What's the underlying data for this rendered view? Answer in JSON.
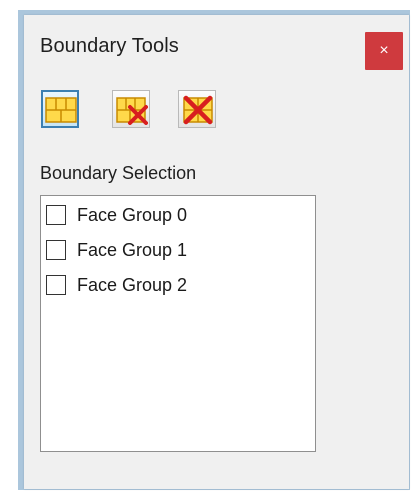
{
  "window": {
    "title": "Boundary Tools",
    "close_label": "×"
  },
  "toolbar": {
    "buttons": [
      {
        "icon": "grid-select-icon",
        "selected": true
      },
      {
        "icon": "grid-remove-icon",
        "selected": false
      },
      {
        "icon": "delete-icon",
        "selected": false
      }
    ]
  },
  "boundary_selection": {
    "label": "Boundary Selection",
    "items": [
      {
        "label": "Face Group 0",
        "checked": false
      },
      {
        "label": "Face Group 1",
        "checked": false
      },
      {
        "label": "Face Group 2",
        "checked": false
      }
    ]
  },
  "colors": {
    "accent": "#3c7fb1",
    "close_bg": "#cf3a3e",
    "icon_yellow": "#ffd94a",
    "icon_red": "#d81f1f",
    "frame": "#abc6dc"
  }
}
